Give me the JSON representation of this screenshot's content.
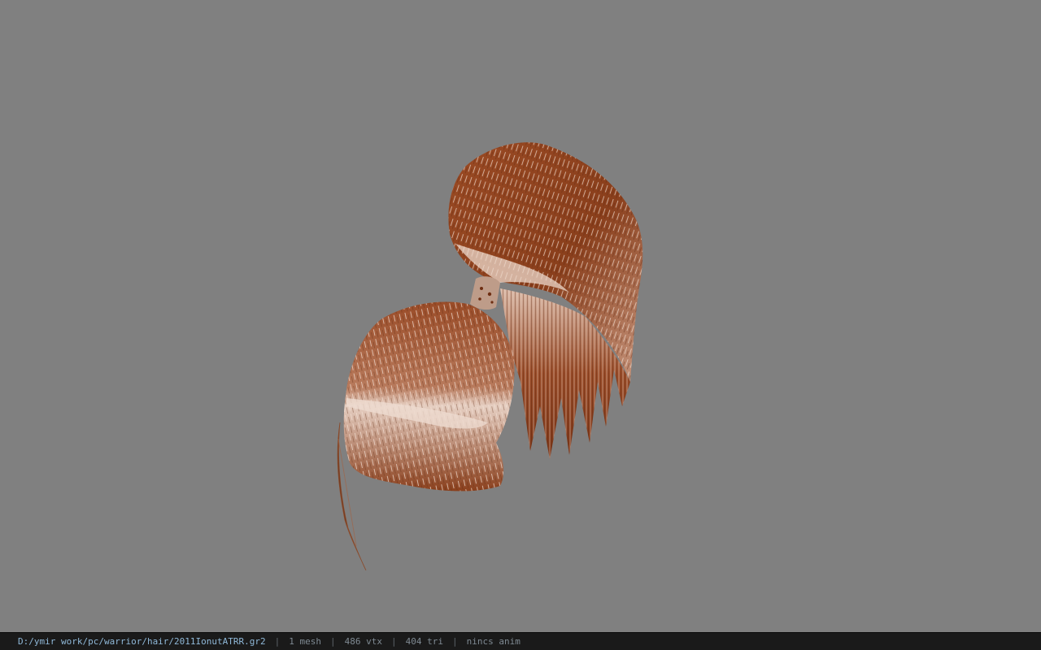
{
  "viewport": {
    "background": "#808080",
    "model": "hair-mesh",
    "hair_colors": {
      "base": "#8a3f1c",
      "dark": "#6e2e12",
      "highlight": "#e8d3c6",
      "tie": "#d9c0b0"
    }
  },
  "status_bar": {
    "file_path": "D:/ymir work/pc/warrior/hair/2011IonutATRR.gr2",
    "mesh_count": "1 mesh",
    "vertex_count": "486 vtx",
    "triangle_count": "404 tri",
    "anim_status": "nincs anim",
    "separator": "|"
  }
}
